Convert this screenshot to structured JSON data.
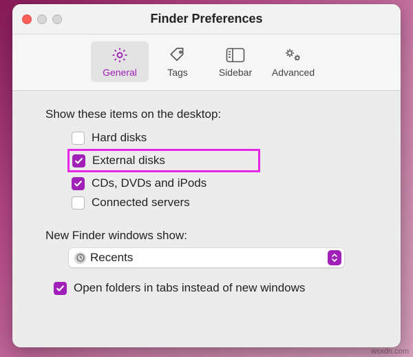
{
  "window": {
    "title": "Finder Preferences"
  },
  "toolbar": {
    "tabs": [
      {
        "label": "General",
        "selected": true
      },
      {
        "label": "Tags",
        "selected": false
      },
      {
        "label": "Sidebar",
        "selected": false
      },
      {
        "label": "Advanced",
        "selected": false
      }
    ]
  },
  "desktopSection": {
    "label": "Show these items on the desktop:",
    "items": [
      {
        "label": "Hard disks",
        "checked": false
      },
      {
        "label": "External disks",
        "checked": true,
        "highlighted": true
      },
      {
        "label": "CDs, DVDs and iPods",
        "checked": true
      },
      {
        "label": "Connected servers",
        "checked": false
      }
    ]
  },
  "newFinder": {
    "label": "New Finder windows show:",
    "selected": "Recents"
  },
  "tabsOption": {
    "label": "Open folders in tabs instead of new windows",
    "checked": true
  },
  "colors": {
    "accent": "#a020b8",
    "highlight": "#e628e6"
  },
  "watermark": "wsxdn.com"
}
